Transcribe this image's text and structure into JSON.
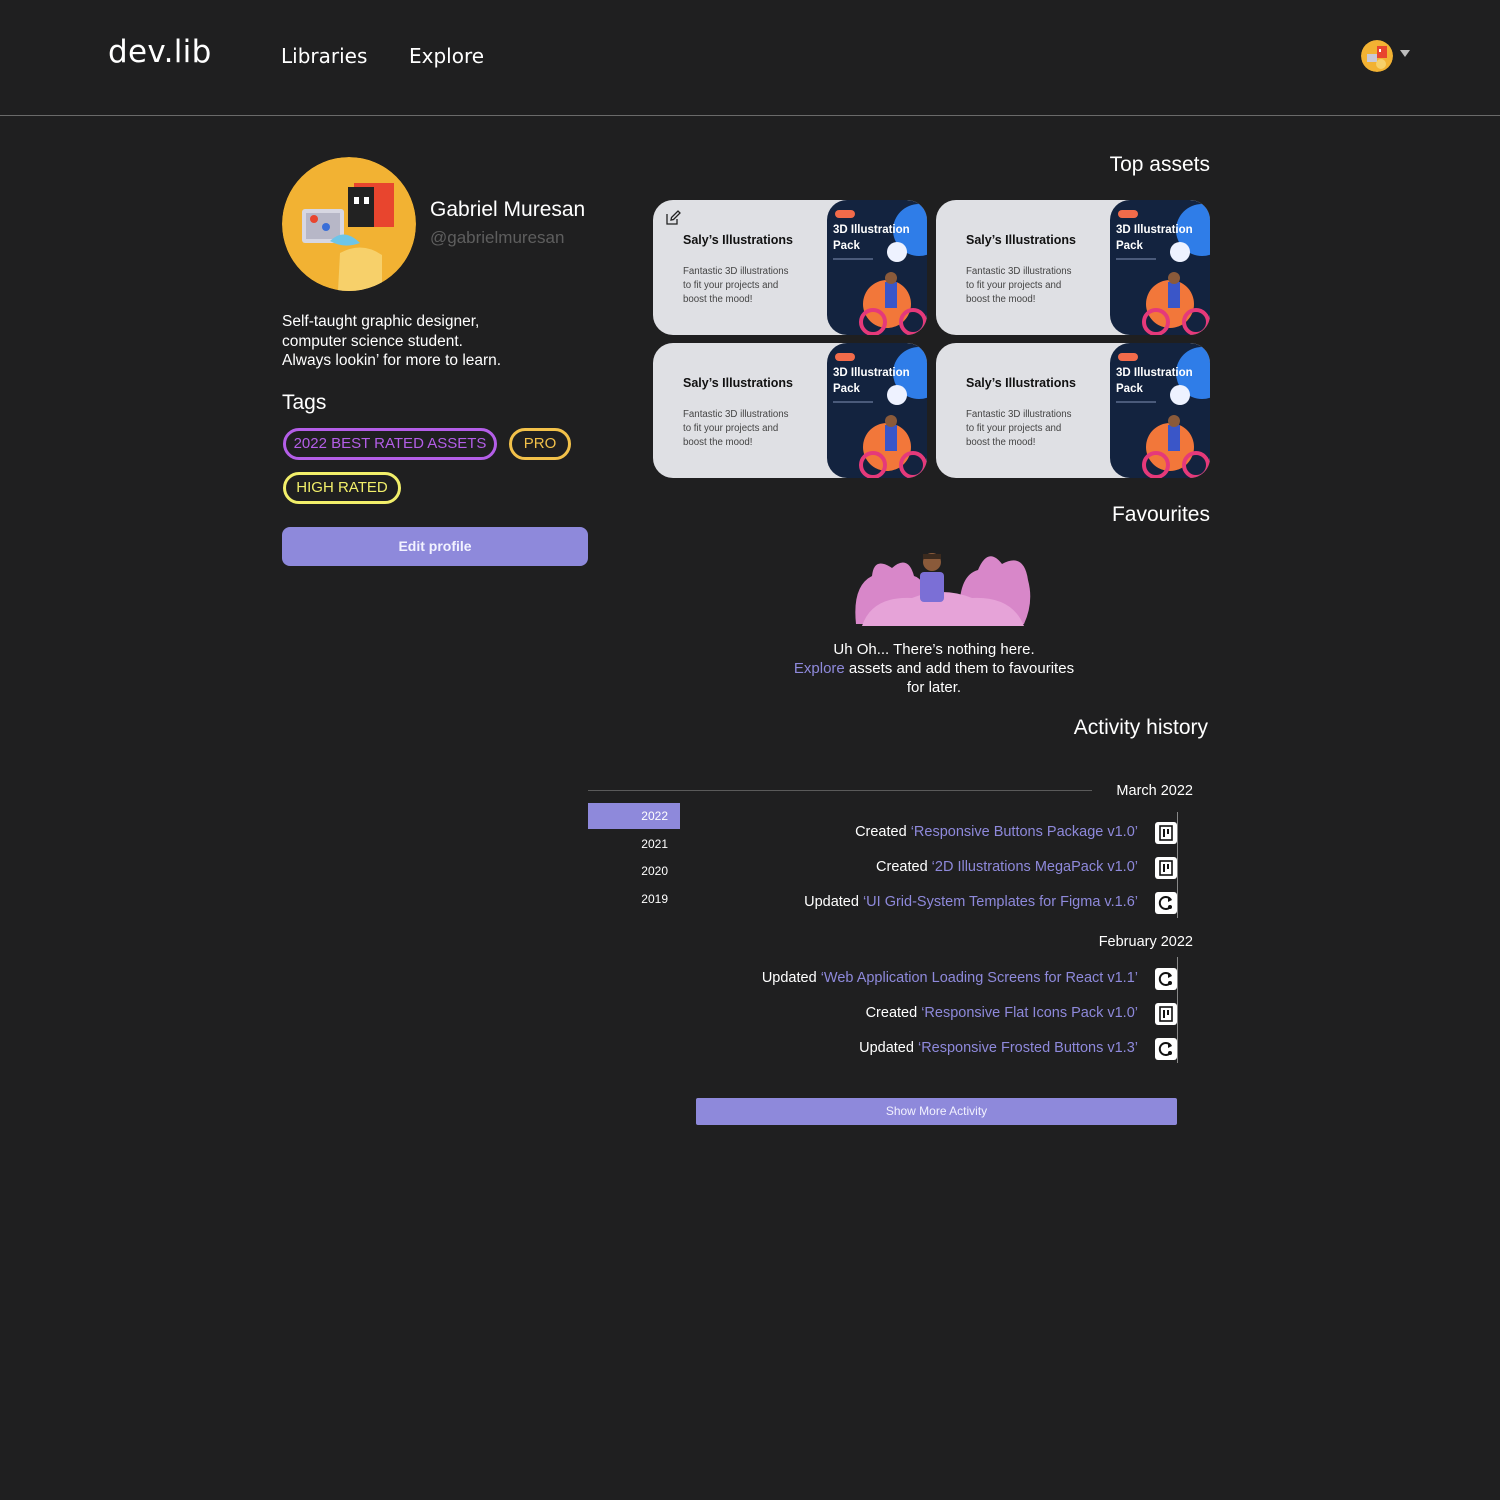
{
  "header": {
    "logo": "dev.lib",
    "nav": [
      "Libraries",
      "Explore"
    ]
  },
  "profile": {
    "name": "Gabriel Muresan",
    "handle": "@gabrielmuresan",
    "bio": [
      "Self-taught graphic designer,",
      "computer science student.",
      "Always lookin’ for more to learn."
    ],
    "tags_title": "Tags",
    "tags": [
      {
        "label": "2022 BEST RATED ASSETS",
        "color": "#b45ee8"
      },
      {
        "label": "PRO",
        "color": "#f2c14a"
      },
      {
        "label": "HIGH RATED",
        "color": "#f2ef6a"
      }
    ],
    "edit_label": "Edit profile"
  },
  "top_assets": {
    "title": "Top assets",
    "cards": [
      {
        "title": "Saly’s Illustrations",
        "desc": [
          "Fantastic 3D illustrations",
          "to fit your projects and",
          "boost the mood!"
        ],
        "thumb_title": [
          "3D Illustration",
          "Pack"
        ]
      },
      {
        "title": "Saly’s Illustrations",
        "desc": [
          "Fantastic 3D illustrations",
          "to fit your projects and",
          "boost the mood!"
        ],
        "thumb_title": [
          "3D Illustration",
          "Pack"
        ]
      },
      {
        "title": "Saly’s Illustrations",
        "desc": [
          "Fantastic 3D illustrations",
          "to fit your projects and",
          "boost the mood!"
        ],
        "thumb_title": [
          "3D Illustration",
          "Pack"
        ]
      },
      {
        "title": "Saly’s Illustrations",
        "desc": [
          "Fantastic 3D illustrations",
          "to fit your projects and",
          "boost the mood!"
        ],
        "thumb_title": [
          "3D Illustration",
          "Pack"
        ]
      }
    ]
  },
  "favourites": {
    "title": "Favourites",
    "line1": "Uh Oh... There’s nothing here.",
    "link": "Explore",
    "line2_rest": " assets and add them to favourites",
    "line3": "for later."
  },
  "activity": {
    "title": "Activity history",
    "years": [
      "2022",
      "2021",
      "2020",
      "2019"
    ],
    "active_year": "2022",
    "groups": [
      {
        "month": "March 2022",
        "items": [
          {
            "action": "Created ",
            "target": "‘Responsive Buttons Package v1.0’",
            "icon": "document-icon"
          },
          {
            "action": "Created ",
            "target": "‘2D Illustrations MegaPack v1.0’",
            "icon": "document-icon"
          },
          {
            "action": "Updated ",
            "target": "‘UI Grid-System Templates for Figma v.1.6’",
            "icon": "refresh-icon"
          }
        ]
      },
      {
        "month": "February 2022",
        "items": [
          {
            "action": "Updated ",
            "target": "‘Web Application Loading Screens for React v1.1’",
            "icon": "refresh-icon"
          },
          {
            "action": "Created ",
            "target": "‘Responsive Flat Icons Pack v1.0’",
            "icon": "document-icon"
          },
          {
            "action": "Updated ",
            "target": "‘Responsive Frosted Buttons v1.3’",
            "icon": "refresh-icon"
          }
        ]
      }
    ],
    "show_more": "Show More Activity"
  },
  "colors": {
    "background": "#1f1f20",
    "accent": "#8e89db"
  }
}
